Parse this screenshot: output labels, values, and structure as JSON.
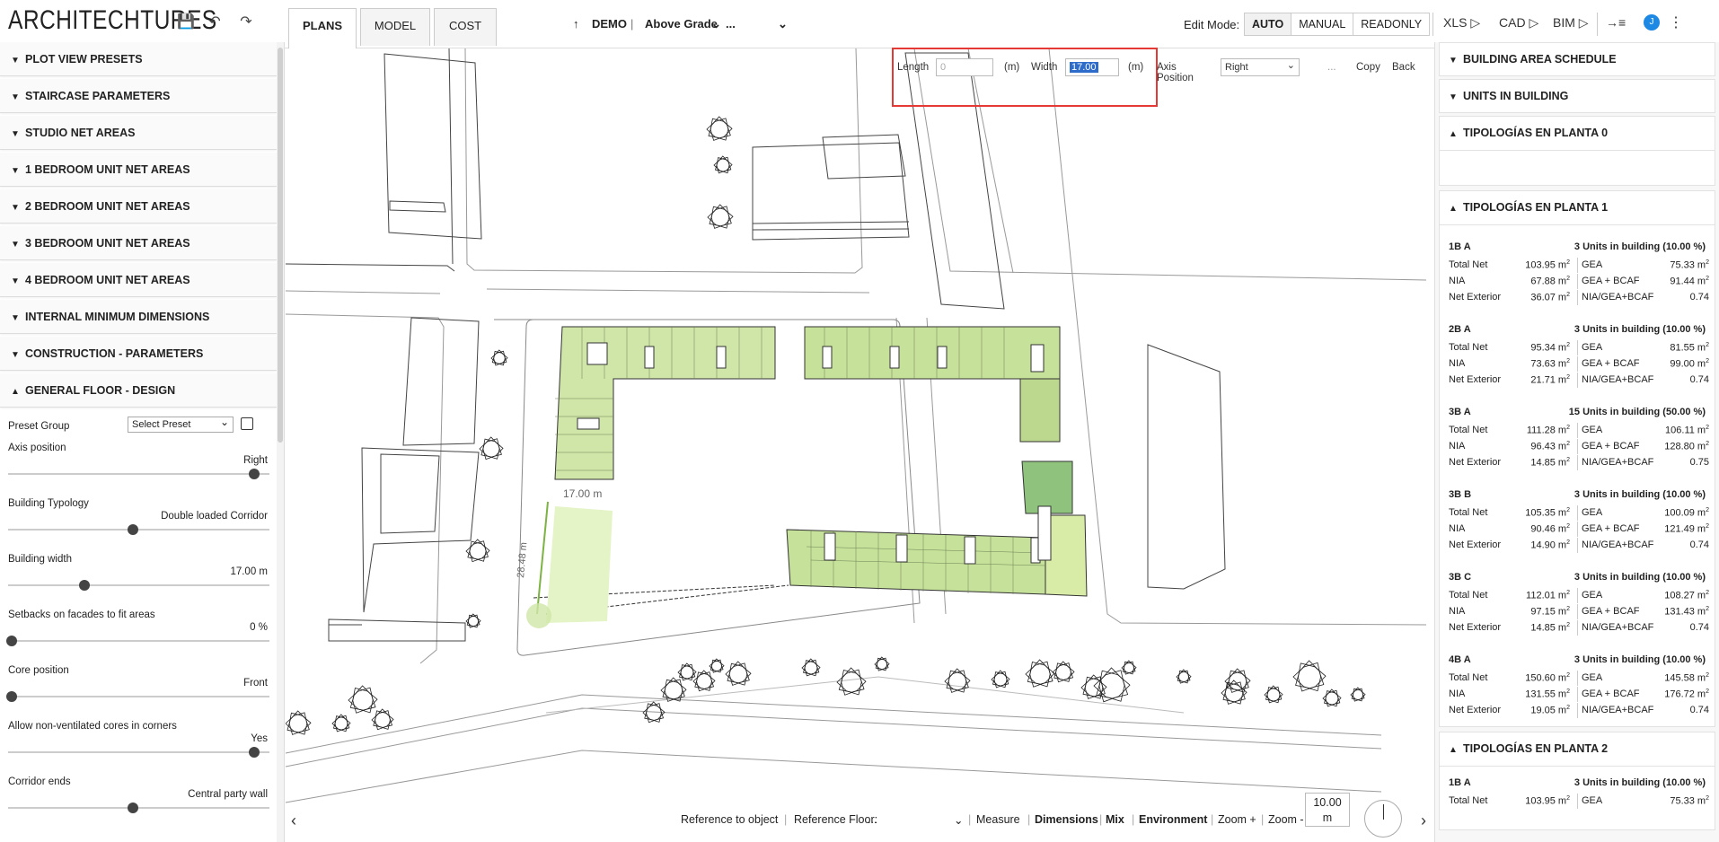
{
  "header": {
    "logo": "ARCHITECHTURES",
    "tabs": [
      {
        "label": "PLANS"
      },
      {
        "label": "MODEL"
      },
      {
        "label": "COST"
      }
    ],
    "project": {
      "name": "DEMO",
      "separator": "|",
      "floor": "Above Grade",
      "ellipsis": "..."
    },
    "edit_mode": {
      "label": "Edit Mode:",
      "options": [
        "AUTO",
        "MANUAL",
        "READONLY"
      ],
      "selected": "AUTO"
    },
    "exports": [
      "XLS",
      "CAD",
      "BIM"
    ],
    "avatar_initial": "J"
  },
  "left": {
    "sections": [
      "PLOT VIEW PRESETS",
      "STAIRCASE PARAMETERS",
      "STUDIO NET AREAS",
      "1 BEDROOM UNIT NET AREAS",
      "2 BEDROOM UNIT NET AREAS",
      "3 BEDROOM UNIT NET AREAS",
      "4 BEDROOM UNIT NET AREAS",
      "INTERNAL MINIMUM DIMENSIONS",
      "CONSTRUCTION - PARAMETERS"
    ],
    "open_section": "GENERAL FLOOR - DESIGN",
    "preset": {
      "label": "Preset Group",
      "value": "Select Preset"
    },
    "params": [
      {
        "label": "Axis position",
        "value": "Right",
        "level": 1.0
      },
      {
        "label": "Building Typology",
        "value": "Double loaded Corridor",
        "level": 0.5
      },
      {
        "label": "Building width",
        "value": "17.00 m",
        "level": 0.3
      },
      {
        "label": "Setbacks on facades to fit areas",
        "value": "0 %",
        "level": 0.0
      },
      {
        "label": "Core position",
        "value": "Front",
        "level": 0.0
      },
      {
        "label": "Allow non-ventilated cores in corners",
        "value": "Yes",
        "level": 1.0
      },
      {
        "label": "Corridor ends",
        "value": "Central party wall",
        "level": 0.5
      }
    ]
  },
  "dimtool": {
    "length_label": "Length",
    "length_value": "0",
    "unit": "(m)",
    "width_label": "Width",
    "width_value": "17.00",
    "axis_label": "Axis Position",
    "axis_value": "Right",
    "more": "...",
    "copy": "Copy",
    "back": "Back"
  },
  "canvas": {
    "dim_width": "17.00 m",
    "dim_length": "28.48 m"
  },
  "bottom": {
    "reference_object": "Reference to object",
    "reference_floor": "Reference Floor:",
    "reference_floor_value": "...",
    "measure": "Measure",
    "dimensions": "Dimensions",
    "mix": "Mix",
    "environment": "Environment",
    "zoom_in": "Zoom +",
    "zoom_out": "Zoom -",
    "scale_value": "10.00",
    "scale_unit": "m"
  },
  "right": {
    "sections": [
      "BUILDING AREA SCHEDULE",
      "UNITS IN BUILDING"
    ],
    "planta0": "TIPOLOGÍAS EN PLANTA 0",
    "planta1": "TIPOLOGÍAS EN PLANTA 1",
    "planta2": "TIPOLOGÍAS EN PLANTA 2",
    "units": [
      {
        "name": "1B A",
        "count": "3 Units in building (10.00 %)",
        "total_net": "103.95 m",
        "gea": "75.33 m",
        "nia": "67.88 m",
        "gea_bcaf": "91.44 m",
        "net_ext": "36.07 m",
        "ratio": "0.74"
      },
      {
        "name": "2B A",
        "count": "3 Units in building (10.00 %)",
        "total_net": "95.34 m",
        "gea": "81.55 m",
        "nia": "73.63 m",
        "gea_bcaf": "99.00 m",
        "net_ext": "21.71 m",
        "ratio": "0.74"
      },
      {
        "name": "3B A",
        "count": "15 Units in building (50.00 %)",
        "total_net": "111.28 m",
        "gea": "106.11 m",
        "nia": "96.43 m",
        "gea_bcaf": "128.80 m",
        "net_ext": "14.85 m",
        "ratio": "0.75"
      },
      {
        "name": "3B B",
        "count": "3 Units in building (10.00 %)",
        "total_net": "105.35 m",
        "gea": "100.09 m",
        "nia": "90.46 m",
        "gea_bcaf": "121.49 m",
        "net_ext": "14.90 m",
        "ratio": "0.74"
      },
      {
        "name": "3B C",
        "count": "3 Units in building (10.00 %)",
        "total_net": "112.01 m",
        "gea": "108.27 m",
        "nia": "97.15 m",
        "gea_bcaf": "131.43 m",
        "net_ext": "14.85 m",
        "ratio": "0.74"
      },
      {
        "name": "4B A",
        "count": "3 Units in building (10.00 %)",
        "total_net": "150.60 m",
        "gea": "145.58 m",
        "nia": "131.55 m",
        "gea_bcaf": "176.72 m",
        "net_ext": "19.05 m",
        "ratio": "0.74"
      }
    ],
    "planta2_unit": {
      "name": "1B A",
      "count": "3 Units in building (10.00 %)",
      "total_net": "103.95 m",
      "gea": "75.33 m"
    },
    "labels": {
      "total_net": "Total Net",
      "gea": "GEA",
      "nia": "NIA",
      "gea_bcaf": "GEA + BCAF",
      "net_ext": "Net Exterior",
      "ratio": "NIA/GEA+BCAF"
    }
  }
}
